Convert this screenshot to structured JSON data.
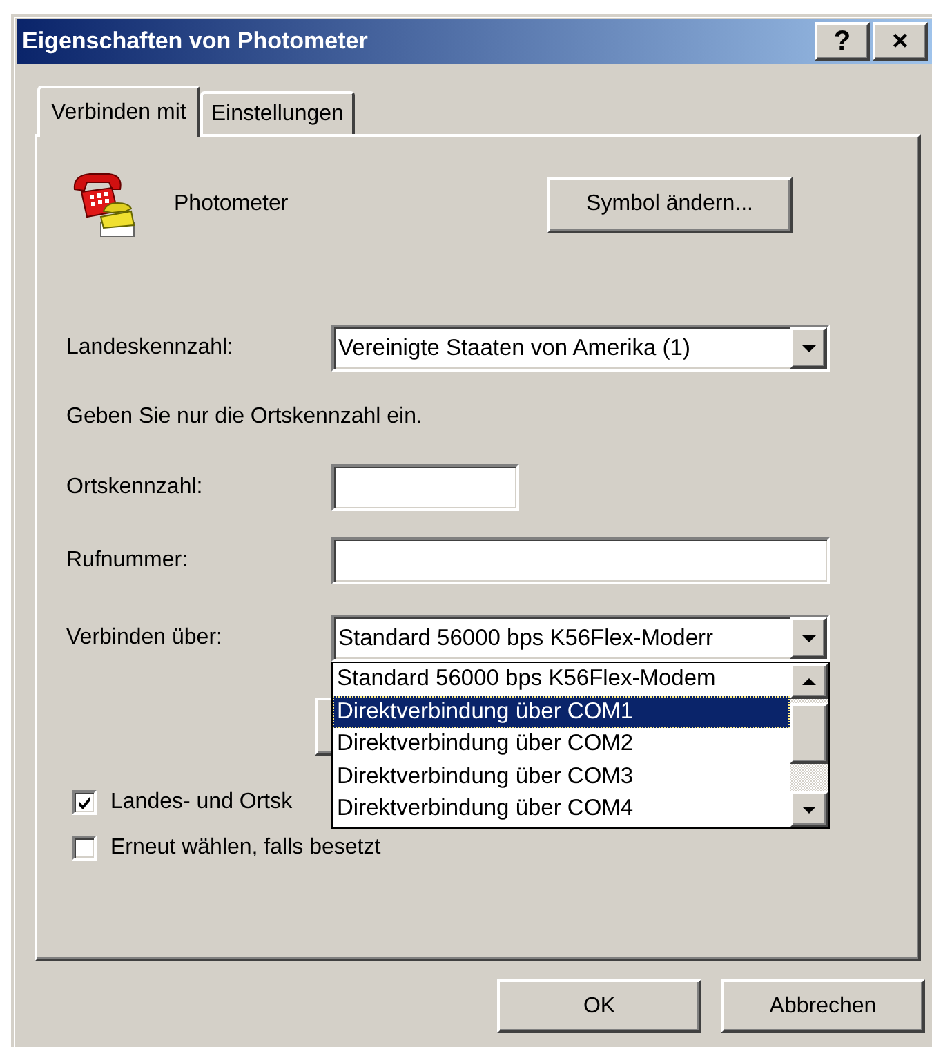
{
  "window": {
    "title": "Eigenschaften von Photometer",
    "title_buttons": [
      "?",
      "×"
    ]
  },
  "tabs": [
    {
      "label": "Verbinden mit",
      "selected": true
    },
    {
      "label": "Einstellungen",
      "selected": false
    }
  ],
  "connection": {
    "name": "Photometer",
    "change_icon_button": "Symbol ändern..."
  },
  "fields": [
    {
      "kind": "combo",
      "label": "Landeskennzahl:",
      "value": "Vereinigte Staaten von Amerika (1)",
      "expanded": false
    },
    {
      "kind": "note",
      "text": "Geben Sie nur die Ortskennzahl ein."
    },
    {
      "kind": "short_input",
      "label": "Ortskennzahl:"
    },
    {
      "kind": "input",
      "label": "Rufnummer:"
    },
    {
      "kind": "combo",
      "label": "Verbinden über:",
      "value": "Standard 56000 bps K56Flex-Moderr",
      "expanded": true,
      "options": [
        {
          "label": "Standard 56000 bps K56Flex-Modem",
          "selected": false
        },
        {
          "label": "Direktverbindung über COM1",
          "selected": true
        },
        {
          "label": "Direktverbindung über COM2",
          "selected": false
        },
        {
          "label": "Direktverbindung über COM3",
          "selected": false
        },
        {
          "label": "Direktverbindung über COM4",
          "selected": false
        }
      ]
    }
  ],
  "checkboxes": [
    {
      "label": "Landes- und Ortsk",
      "checked": true
    },
    {
      "label": "Erneut wählen, falls besetzt",
      "checked": false
    }
  ],
  "buttons": [
    "OK",
    "Abbrechen"
  ]
}
